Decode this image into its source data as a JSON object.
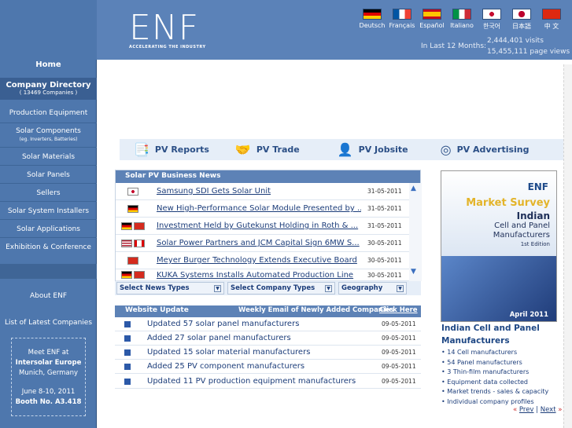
{
  "header": {
    "logo_text": "ENF",
    "logo_tagline": "ACCELERATING THE INDUSTRY",
    "languages": [
      {
        "label": "Deutsch",
        "flag": "de"
      },
      {
        "label": "Français",
        "flag": "fr"
      },
      {
        "label": "Español",
        "flag": "es"
      },
      {
        "label": "Italiano",
        "flag": "it"
      },
      {
        "label": "한국어",
        "flag": "kr"
      },
      {
        "label": "日本語",
        "flag": "jp"
      },
      {
        "label": "中 文",
        "flag": "cn"
      }
    ],
    "stats_label": "In Last 12 Months:",
    "visits": "2,444,401  visits",
    "page_views": "15,455,111  page views"
  },
  "sidebar": {
    "home": "Home",
    "company_directory": "Company Directory",
    "company_count": "( 13469  Companies )",
    "items": [
      "Production Equipment",
      "Solar Components",
      "(eg. Inverters, Batteries)",
      "Solar Materials",
      "Solar Panels",
      "Sellers",
      "Solar System Installers",
      "Solar Applications",
      "Exhibition & Conference"
    ],
    "about": "About ENF",
    "latest": "List of Latest Companies",
    "meet": {
      "line1": "Meet ENF at",
      "line2": "Intersolar Europe",
      "line3": "Munich, Germany",
      "line4": "June 8-10, 2011",
      "line5": "Booth No. A3.418"
    }
  },
  "pv_links": [
    "PV Reports",
    "PV Trade",
    "PV Jobsite",
    "PV Advertising"
  ],
  "news": {
    "title": "Solar PV Business News",
    "rows": [
      {
        "title": "Samsung SDI Gets Solar Unit",
        "date": "31-05-2011",
        "flags": [
          "kr"
        ]
      },
      {
        "title": "New High-Performance Solar Module Presented by ...",
        "date": "31-05-2011",
        "flags": [
          "de"
        ]
      },
      {
        "title": "Investment Held by Gutekunst Holding in Roth & ...",
        "date": "31-05-2011",
        "flags": [
          "de",
          "ch"
        ]
      },
      {
        "title": "Solar Power Partners and JCM Capital Sign 6MW S...",
        "date": "30-05-2011",
        "flags": [
          "us",
          "ca"
        ]
      },
      {
        "title": "Meyer Burger Technology Extends Executive Board",
        "date": "30-05-2011",
        "flags": [
          "ch"
        ]
      },
      {
        "title": "KUKA Systems Installs Automated Production Line",
        "date": "30-05-2011",
        "flags": [
          "de",
          "ch"
        ]
      }
    ],
    "filters": [
      "Select News Types",
      "Select Company Types",
      "Geography"
    ]
  },
  "website_update": {
    "title": "Website Update",
    "weekly_label": "Weekly Email of Newly Added Companies",
    "click_here": "Click Here",
    "rows": [
      {
        "text": "Updated 57 solar panel manufacturers",
        "date": "09-05-2011"
      },
      {
        "text": "Added 27 solar panel manufacturers",
        "date": "09-05-2011"
      },
      {
        "text": "Updated 15 solar material manufacturers",
        "date": "09-05-2011"
      },
      {
        "text": "Added 25 PV component manufacturers",
        "date": "09-05-2011"
      },
      {
        "text": "Updated 11 PV production equipment manufacturers",
        "date": "09-05-2011"
      }
    ]
  },
  "ad": {
    "brand": "ENF",
    "l1": "Market Survey",
    "l2": "Indian",
    "l3": "Cell and Panel",
    "l4": "Manufacturers",
    "l5": "1st Edition",
    "date": "April 2011",
    "title": "Indian Cell and Panel Manufacturers",
    "bullets": [
      "• 14 Cell manufacturers",
      "• 54 Panel manufacturers",
      "• 3 Thin-film manufacturers",
      "• Equipment data collected",
      "• Market trends - sales & capacity",
      "• Individual company profiles"
    ],
    "prev": "Prev",
    "next": "Next",
    "sep": "|",
    "lq": "«",
    "rq": "»"
  }
}
